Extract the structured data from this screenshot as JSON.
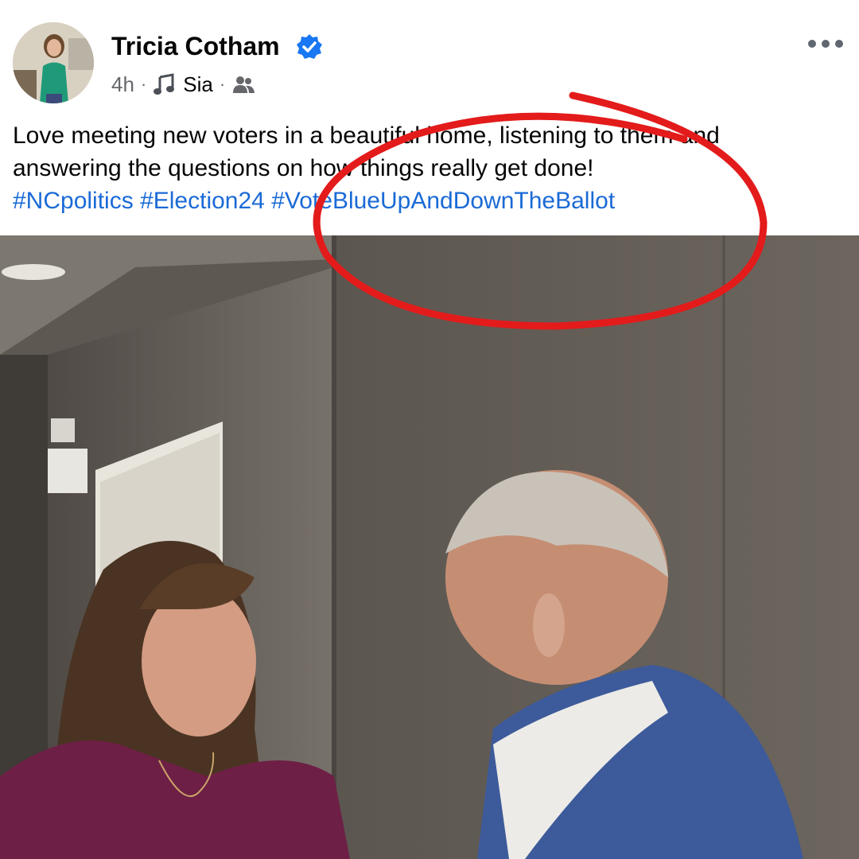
{
  "post": {
    "author": "Tricia Cotham",
    "time": "4h",
    "music": "Sia",
    "separator": "·",
    "caption_line1": "Love meeting new voters in a beautiful home, listening to them and",
    "caption_line2": "answering the questions on how things really get done!",
    "hashtags": [
      "#NCpolitics",
      "#Election24",
      "#VoteBlueUpAndDownTheBallot"
    ]
  },
  "colors": {
    "verified": "#1877f2",
    "hashtag": "#1a6ad6",
    "annotation": "#e31b1b"
  },
  "icons": {
    "verified": "verified-badge-icon",
    "music": "music-note-icon",
    "audience": "friends-audience-icon",
    "more": "more-options-icon"
  }
}
